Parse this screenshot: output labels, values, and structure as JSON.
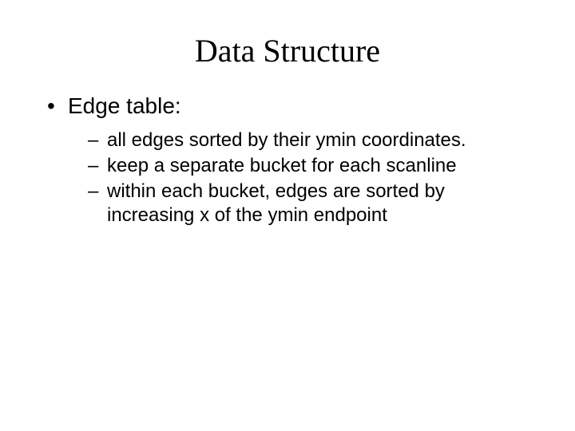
{
  "slide": {
    "title": "Data Structure",
    "bullet": "Edge table:",
    "sub": [
      "all edges sorted by their ymin coordinates.",
      "keep a separate bucket for each scanline",
      "within each bucket, edges are sorted by increasing x of the ymin endpoint"
    ]
  }
}
